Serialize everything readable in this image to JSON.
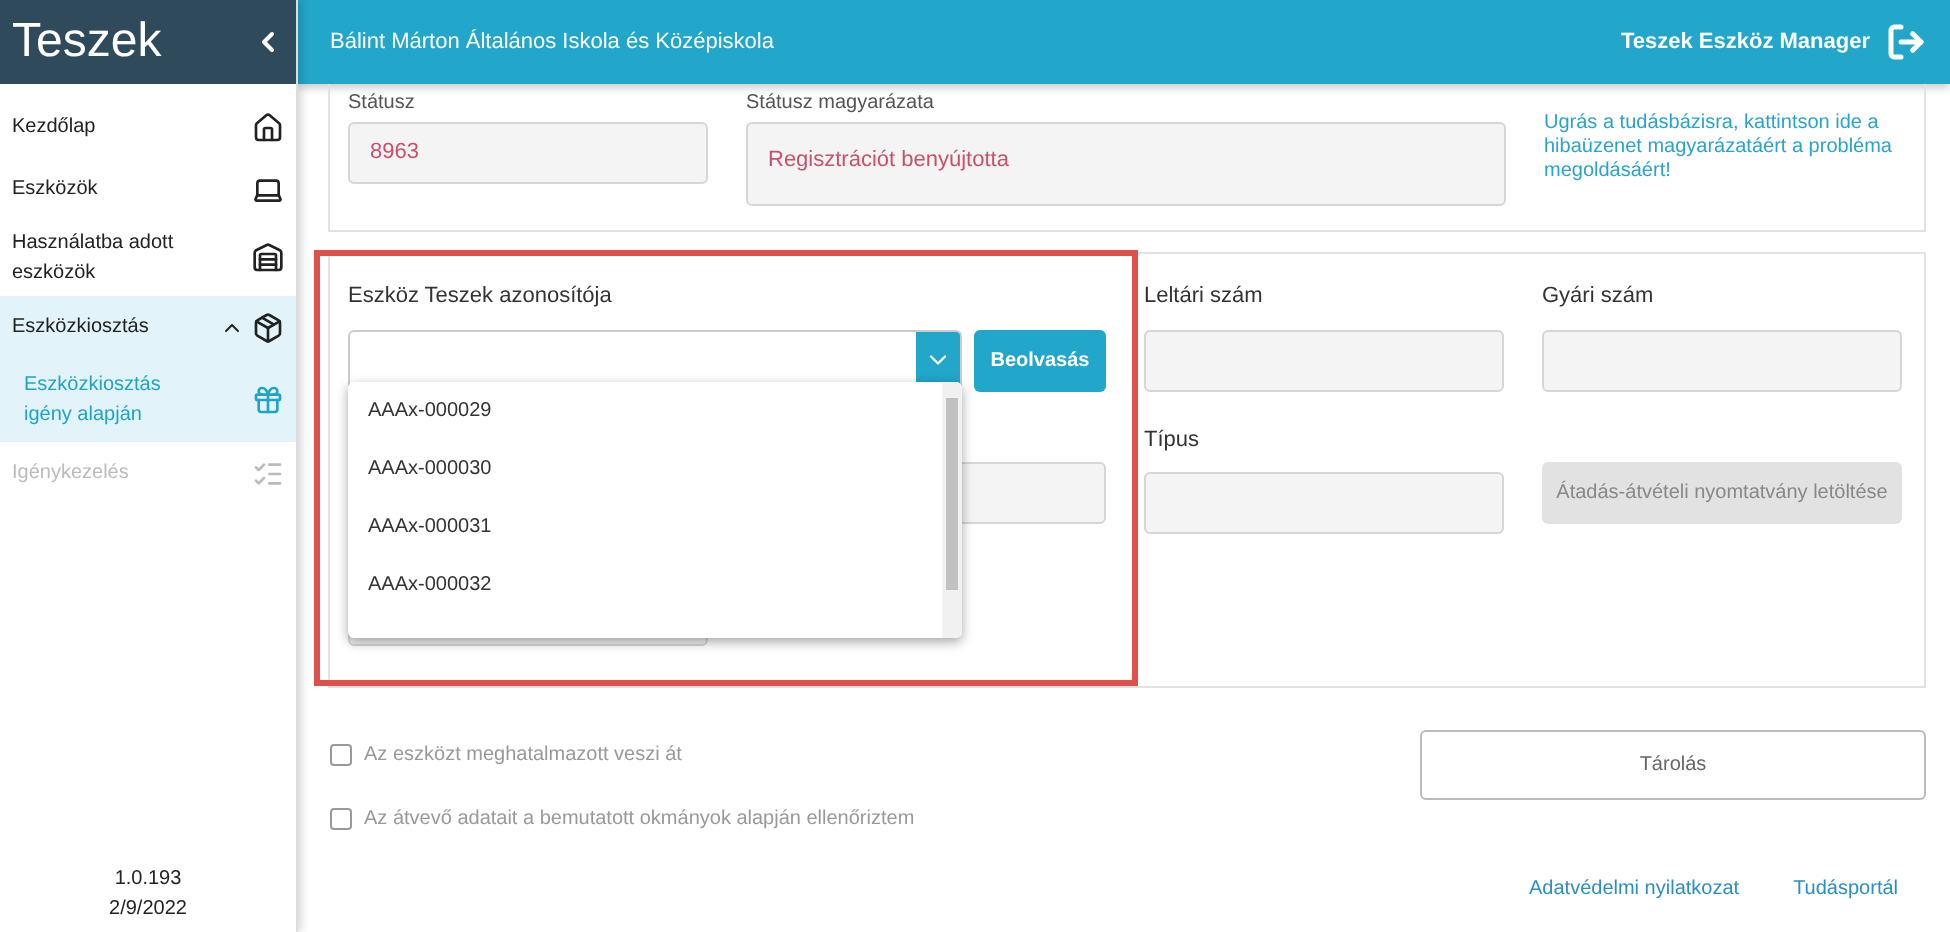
{
  "sidebar": {
    "title": "Teszek",
    "items": [
      {
        "label": "Kezdőlap",
        "selected": false,
        "disabled": false
      },
      {
        "label": "Eszközök",
        "selected": false,
        "disabled": false
      },
      {
        "label": "Használatba adott eszközök",
        "selected": false,
        "disabled": false
      },
      {
        "label": "Eszközkiosztás",
        "selected": false,
        "disabled": false,
        "expanded": true,
        "children": [
          {
            "label": "Eszközkiosztás igény alapján",
            "selected": true
          }
        ]
      },
      {
        "label": "Igénykezelés",
        "selected": false,
        "disabled": true
      }
    ],
    "version": "1.0.193",
    "date": "2/9/2022"
  },
  "header": {
    "school": "Bálint Márton Általános Iskola és Középiskola",
    "app": "Teszek Eszköz Manager"
  },
  "status_card": {
    "status_label": "Státusz",
    "status_value": "8963",
    "explanation_label": "Státusz magyarázata",
    "explanation_value": "Regisztrációt benyújtotta",
    "help_link": "Ugrás a tudásbázisra, kattintson ide a hibaüzenet magyarázatáért a probléma megoldásáért!"
  },
  "device_card": {
    "id_label": "Eszköz Teszek azonosítója",
    "scan_button": "Beolvasás",
    "inventory_label": "Leltári szám",
    "serial_label": "Gyári szám",
    "type_label": "Típus",
    "download_button": "Átadás-átvételi nyomtatvány letöltése",
    "download_disabled": true,
    "dropdown_options": [
      {
        "label": "AAAx-000029",
        "selected": false
      },
      {
        "label": "AAAx-000030",
        "selected": false
      },
      {
        "label": "AAAx-000031",
        "selected": false
      },
      {
        "label": "AAAx-000032",
        "selected": false
      }
    ]
  },
  "checkboxes": [
    {
      "label": "Az eszközt meghatalmazott veszi át",
      "checked": false
    },
    {
      "label": "Az átvevő adatait a bemutatott okmányok alapján ellenőriztem",
      "checked": false
    }
  ],
  "save_button": "Tárolás",
  "footer_links": [
    "Adatvédelmi nyilatkozat",
    "Tudásportál"
  ]
}
